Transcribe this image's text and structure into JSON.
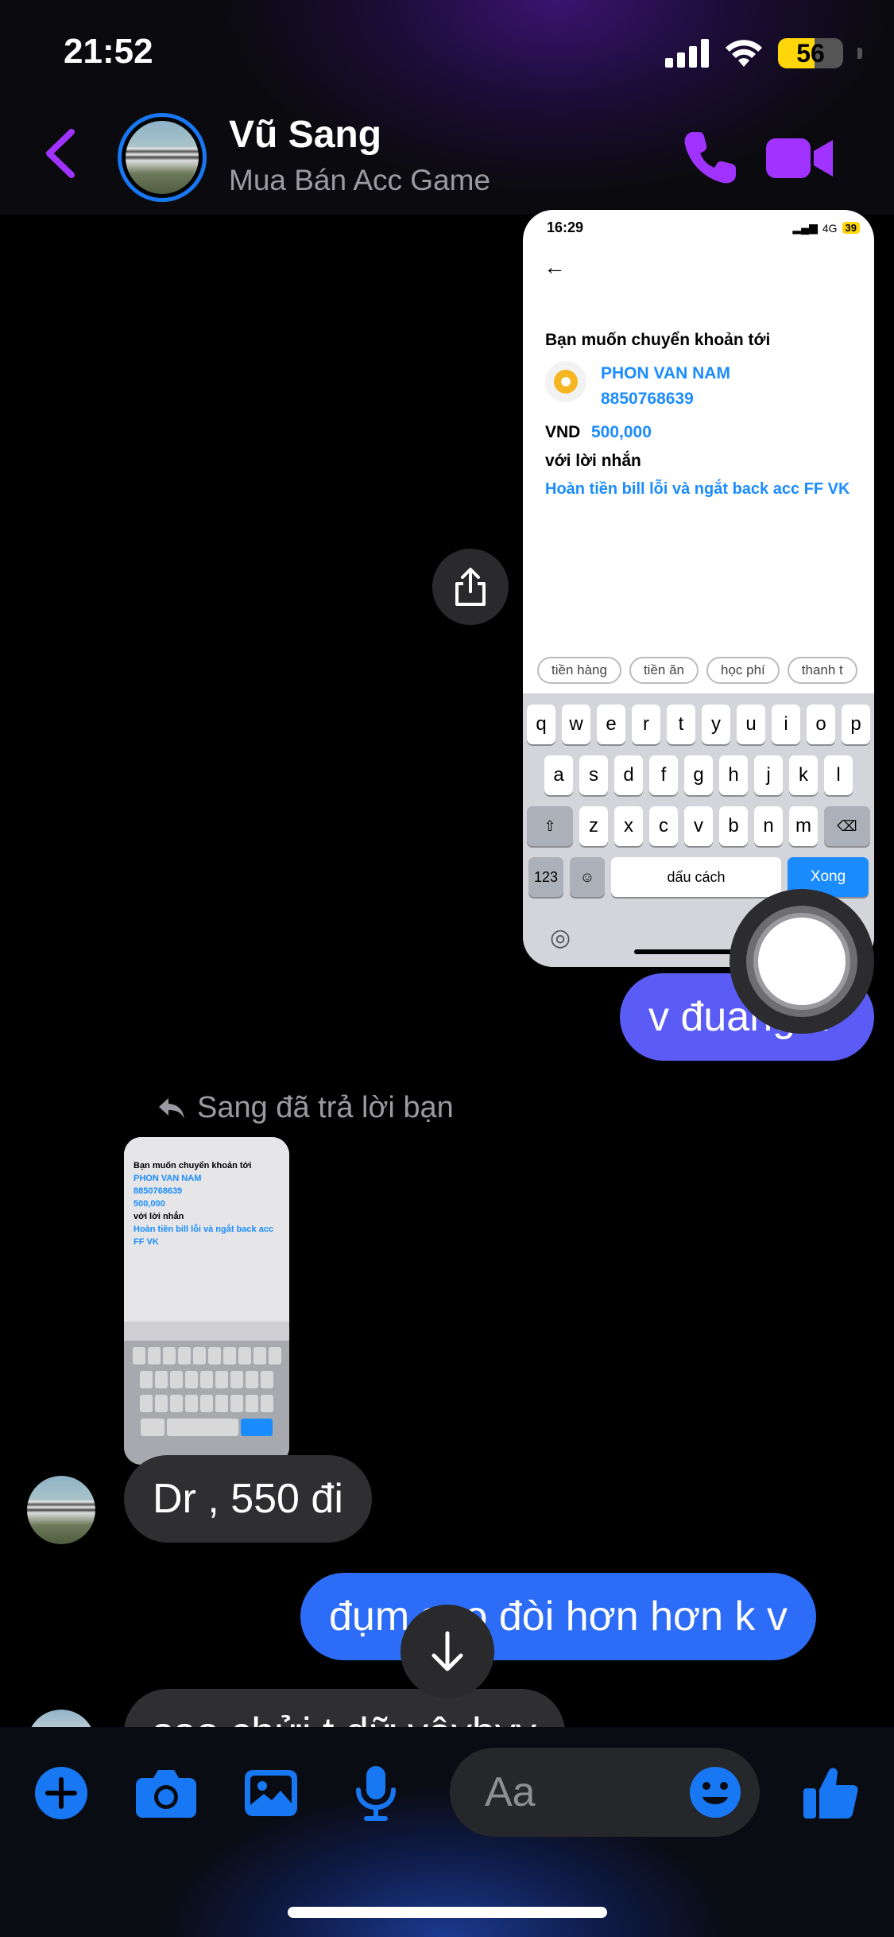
{
  "status_bar": {
    "time": "21:52",
    "battery": "56"
  },
  "header": {
    "name": "Vũ Sang",
    "subtitle": "Mua Bán Acc Game"
  },
  "shared_screenshot": {
    "time": "16:29",
    "network": "4G",
    "battery": "39",
    "prompt": "Bạn muốn chuyển khoản tới",
    "recipient_name": "PHON VAN NAM",
    "account_number": "8850768639",
    "currency": "VND",
    "amount": "500,000",
    "message_label": "với lời nhắn",
    "message": "Hoàn tiền bill lỗi và ngắt back acc FF VK",
    "chips": [
      "tiền hàng",
      "tiền ăn",
      "học phí",
      "thanh t"
    ],
    "keyboard_row1": [
      "q",
      "w",
      "e",
      "r",
      "t",
      "y",
      "u",
      "i",
      "o",
      "p"
    ],
    "keyboard_row2": [
      "a",
      "s",
      "d",
      "f",
      "g",
      "h",
      "j",
      "k",
      "l"
    ],
    "keyboard_row3": [
      "z",
      "x",
      "c",
      "v",
      "b",
      "n",
      "m"
    ],
    "key_123": "123",
    "space_label": "dấu cách",
    "done_label": "Xong"
  },
  "messages": {
    "out1": "v đuang k",
    "reply_note": "Sang đã trả lời bạn",
    "in1": "Dr , 550 đi",
    "out2": "đụm sao đòi hơn hơn k v",
    "in2": "sao chửi t dữ vậybyy"
  },
  "composer": {
    "placeholder": "Aa"
  },
  "colors": {
    "accent": "#a033ff",
    "messenger_blue": "#1877f2",
    "outgoing": "#2c6cf6"
  }
}
